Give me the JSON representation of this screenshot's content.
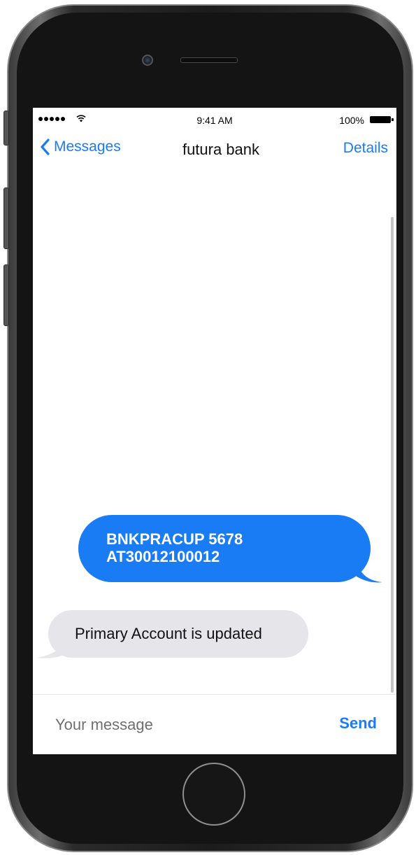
{
  "status_bar": {
    "time": "9:41 AM",
    "battery": "100%",
    "signal_icon": "signal-dots-icon",
    "wifi_icon": "wifi-icon",
    "battery_icon": "battery-icon"
  },
  "nav": {
    "back_label": "Messages",
    "back_icon": "chevron-left-icon",
    "contact_name": "futura bank",
    "details_label": "Details"
  },
  "messages": [
    {
      "direction": "outgoing",
      "text": "BNKPRACUP 5678\nAT30012100012"
    },
    {
      "direction": "incoming",
      "text": "Primary Account is updated"
    }
  ],
  "composer": {
    "placeholder": "Your message",
    "value": "",
    "send_label": "Send"
  },
  "colors": {
    "accent": "#1a7cf5",
    "incoming_bubble": "#e6e6ea",
    "phone_body": "#1c1c1c"
  }
}
